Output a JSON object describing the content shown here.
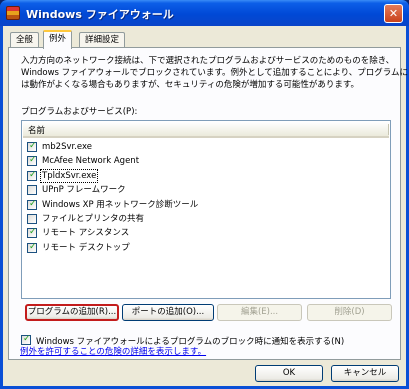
{
  "window": {
    "title": "Windows ファイアウォール",
    "close_glyph": "✕"
  },
  "tabs": [
    {
      "label": "全般",
      "active": false
    },
    {
      "label": "例外",
      "active": true
    },
    {
      "label": "詳細設定",
      "active": false
    }
  ],
  "description": [
    "入力方向のネットワーク接続は、下で選択されたプログラムおよびサービスのためのものを除き、",
    "Windows ファイアウォールでブロックされています。例外として追加することにより、プログラムによって",
    "は動作がよくなる場合もありますが、セキュリティの危険が増加する可能性があります。"
  ],
  "list": {
    "label": "プログラムおよびサービス(P):",
    "header": "名前",
    "items": [
      {
        "label": "mb2Svr.exe",
        "checked": true,
        "selected": false
      },
      {
        "label": "McAfee Network Agent",
        "checked": true,
        "selected": false
      },
      {
        "label": "TpldxSvr.exe",
        "checked": true,
        "selected": true
      },
      {
        "label": "UPnP フレームワーク",
        "checked": false,
        "selected": false
      },
      {
        "label": "Windows XP 用ネットワーク診断ツール",
        "checked": true,
        "selected": false
      },
      {
        "label": "ファイルとプリンタの共有",
        "checked": false,
        "selected": false
      },
      {
        "label": "リモート アシスタンス",
        "checked": true,
        "selected": false
      },
      {
        "label": "リモート デスクトップ",
        "checked": true,
        "selected": false
      }
    ],
    "check_glyph": "✓"
  },
  "buttons": {
    "add_program": "プログラムの追加(R)...",
    "add_port": "ポートの追加(O)...",
    "edit": "編集(E)...",
    "delete": "削除(D)"
  },
  "notify": {
    "label": "Windows ファイアウォールによるプログラムのブロック時に通知を表示する(N)",
    "checked": true
  },
  "link_text": "例外を許可することの危険の詳細を表示します。",
  "footer": {
    "ok": "OK",
    "cancel": "キャンセル"
  }
}
